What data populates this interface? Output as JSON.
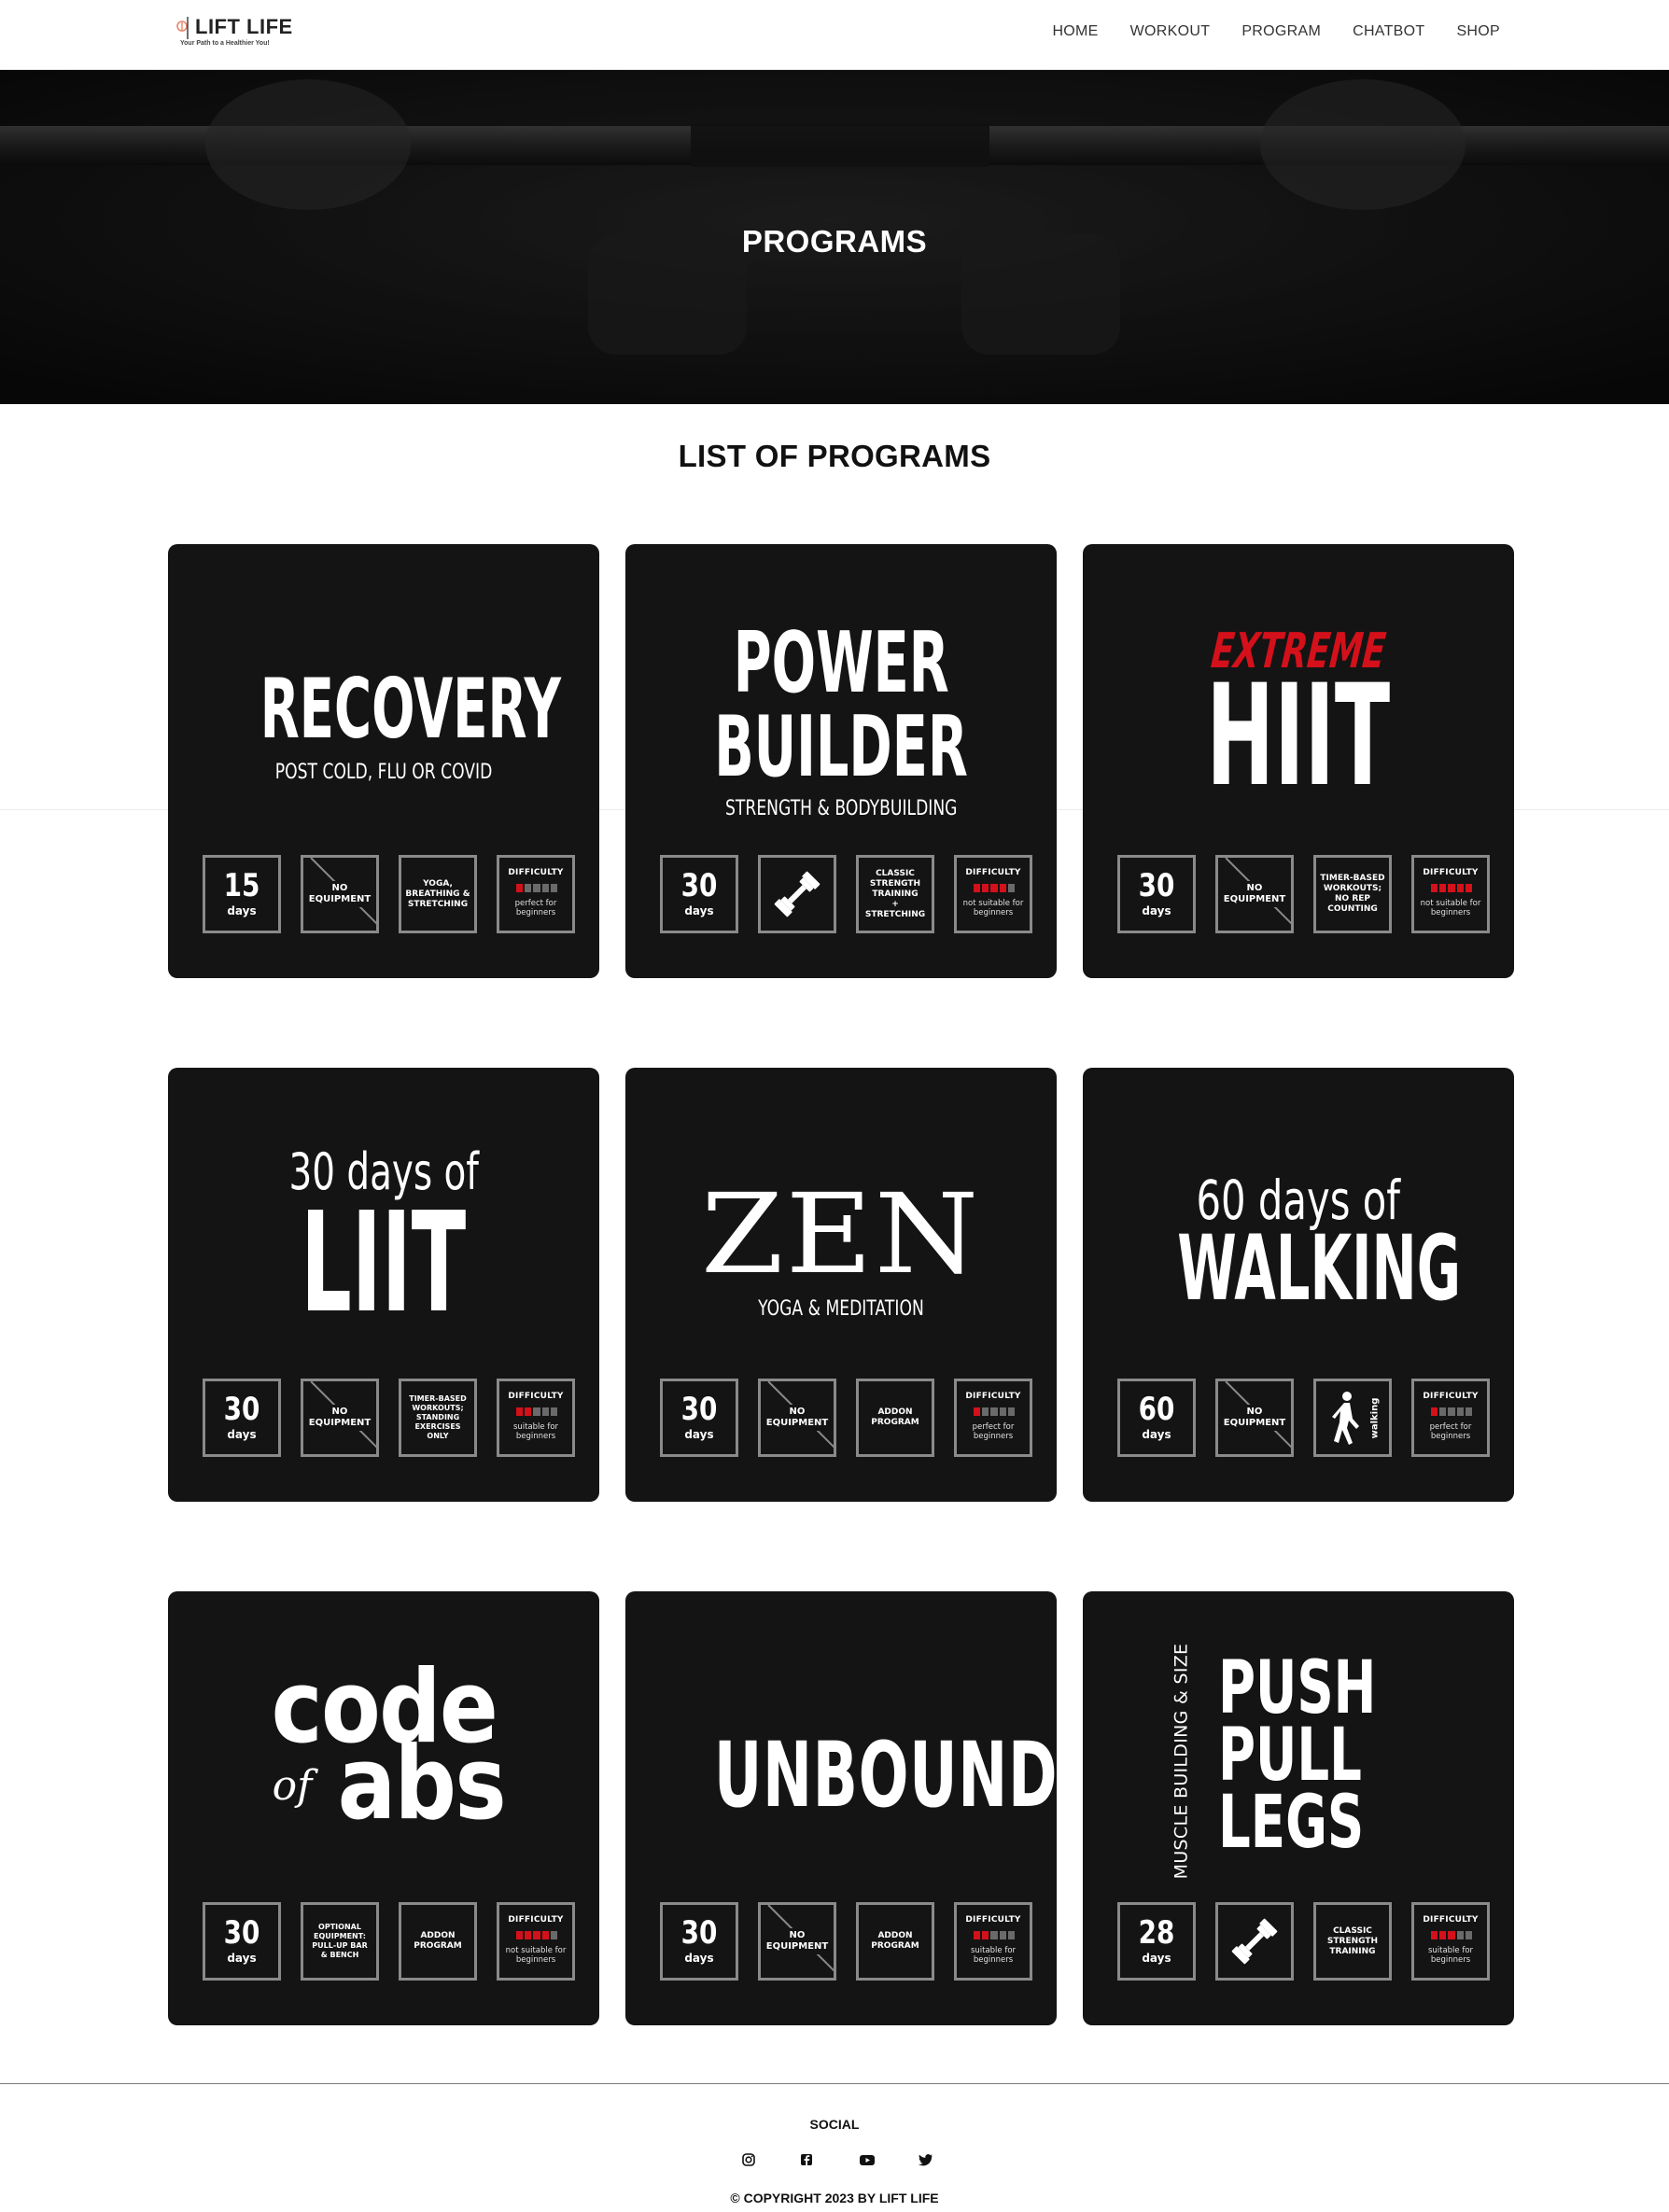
{
  "header": {
    "logo_text": "LIFT LIFE",
    "logo_tagline": "Your Path to a Healthier You!",
    "nav": [
      "HOME",
      "WORKOUT",
      "PROGRAM",
      "CHATBOT",
      "SHOP"
    ]
  },
  "hero": {
    "title": "PROGRAMS"
  },
  "section": {
    "title": "LIST OF PROGRAMS"
  },
  "programs": [
    {
      "title_lines": [
        "RECOVERY"
      ],
      "subtitle": "POST COLD, FLU OR COVID",
      "days": "15",
      "days_label": "days",
      "equipment": "NO\nEQUIPMENT",
      "focus": "YOGA,\nBREATHING &\nSTRETCHING",
      "difficulty_label": "DIFFICULTY",
      "difficulty_level": 1,
      "difficulty_note": "perfect for\nbeginners"
    },
    {
      "title_lines": [
        "POWER",
        "BUILDER"
      ],
      "subtitle": "STRENGTH & BODYBUILDING",
      "days": "30",
      "days_label": "days",
      "equipment_icon": "dumbbell-icon",
      "focus": "CLASSIC\nSTRENGTH\nTRAINING\n+ STRETCHING",
      "difficulty_label": "DIFFICULTY",
      "difficulty_level": 4,
      "difficulty_note": "not suitable for\nbeginners"
    },
    {
      "title_lines": [
        "EXTREME",
        "HIIT"
      ],
      "subtitle": "",
      "days": "30",
      "days_label": "days",
      "equipment": "NO\nEQUIPMENT",
      "focus": "TIMER-BASED\nWORKOUTS;\nNO REP\nCOUNTING",
      "difficulty_label": "DIFFICULTY",
      "difficulty_level": 5,
      "difficulty_note": "not suitable for\nbeginners"
    },
    {
      "title_lines": [
        "30 days of",
        "LIIT"
      ],
      "subtitle": "",
      "days": "30",
      "days_label": "days",
      "equipment": "NO\nEQUIPMENT",
      "focus": "TIMER-BASED\nWORKOUTS;\nSTANDING\nEXERCISES ONLY",
      "difficulty_label": "DIFFICULTY",
      "difficulty_level": 2,
      "difficulty_note": "suitable for\nbeginners"
    },
    {
      "title_lines": [
        "ZEN"
      ],
      "subtitle": "YOGA & MEDITATION",
      "days": "30",
      "days_label": "days",
      "equipment": "NO\nEQUIPMENT",
      "focus": "ADDON\nPROGRAM",
      "difficulty_label": "DIFFICULTY",
      "difficulty_level": 1,
      "difficulty_note": "perfect for\nbeginners"
    },
    {
      "title_lines": [
        "60 days of",
        "WALKING"
      ],
      "subtitle": "",
      "days": "60",
      "days_label": "days",
      "equipment": "NO\nEQUIPMENT",
      "focus_icon": "walking-icon",
      "focus": "walking",
      "difficulty_label": "DIFFICULTY",
      "difficulty_level": 1,
      "difficulty_note": "perfect for\nbeginners"
    },
    {
      "title_lines": [
        "code",
        "of",
        "abs"
      ],
      "subtitle": "",
      "days": "30",
      "days_label": "days",
      "equipment": "OPTIONAL\nEQUIPMENT:\nPULL-UP BAR\n& BENCH",
      "focus": "ADDON\nPROGRAM",
      "difficulty_label": "DIFFICULTY",
      "difficulty_level": 4,
      "difficulty_note": "not suitable for\nbeginners"
    },
    {
      "title_lines": [
        "UNBOUND"
      ],
      "subtitle": "",
      "days": "30",
      "days_label": "days",
      "equipment": "NO\nEQUIPMENT",
      "focus": "ADDON\nPROGRAM",
      "difficulty_label": "DIFFICULTY",
      "difficulty_level": 2,
      "difficulty_note": "suitable for\nbeginners"
    },
    {
      "title_lines": [
        "PUSH",
        "PULL",
        "LEGS"
      ],
      "subtitle": "MUSCLE BUILDING & SIZE",
      "days": "28",
      "days_label": "days",
      "equipment_icon": "dumbbell-icon",
      "focus": "CLASSIC\nSTRENGTH\nTRAINING",
      "difficulty_label": "DIFFICULTY",
      "difficulty_level": 3,
      "difficulty_note": "suitable for\nbeginners"
    }
  ],
  "footer": {
    "social_title": "SOCIAL",
    "social_icons": [
      "instagram-icon",
      "facebook-icon",
      "youtube-icon",
      "twitter-icon"
    ],
    "copyright": "© COPYRIGHT 2023 BY LIFT LIFE"
  },
  "colors": {
    "card_bg": "#141414",
    "accent_red": "#d4101a",
    "badge_border": "#8a8a8a"
  }
}
